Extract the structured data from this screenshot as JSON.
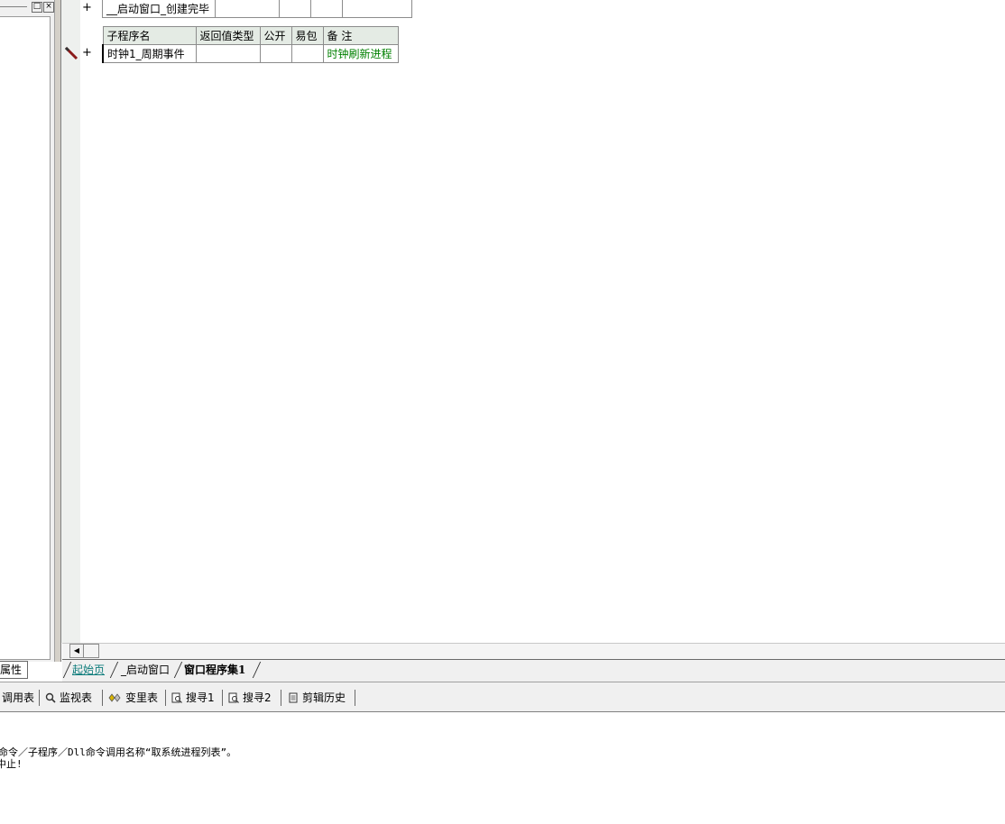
{
  "left_panel": {
    "restore_label": "□",
    "close_label": "×",
    "tab_label": "属性"
  },
  "editor": {
    "top_row": {
      "name": "__启动窗口_创建完毕"
    },
    "table": {
      "headers": [
        "子程序名",
        "返回值类型",
        "公开",
        "易包",
        "备 注"
      ],
      "row": {
        "name": "时钟1_周期事件",
        "return_type": "",
        "public": "",
        "easy_pkg": "",
        "note": "时钟刷新进程"
      }
    },
    "plus_label": "+"
  },
  "doc_tabs": [
    {
      "label": "起始页"
    },
    {
      "label": "_启动窗口"
    },
    {
      "label": "窗口程序集1"
    }
  ],
  "bottom_tools": [
    {
      "label": "调用表",
      "icon": "call-table-icon"
    },
    {
      "label": "监视表",
      "icon": "magnifier-icon"
    },
    {
      "label": "变里表",
      "icon": "variable-table-icon"
    },
    {
      "label": "搜寻1",
      "icon": "search-doc-icon"
    },
    {
      "label": "搜寻2",
      "icon": "search-doc-icon"
    },
    {
      "label": "剪辑历史",
      "icon": "clipboard-history-icon"
    }
  ],
  "output": {
    "lines": [
      "命令／子程序／Dll命令调用名称“取系统进程列表”。",
      "中止!"
    ]
  },
  "colors": {
    "note_green": "#008000",
    "start_tab": "#0e7c7b",
    "header_bg": "#e4ebe4"
  }
}
